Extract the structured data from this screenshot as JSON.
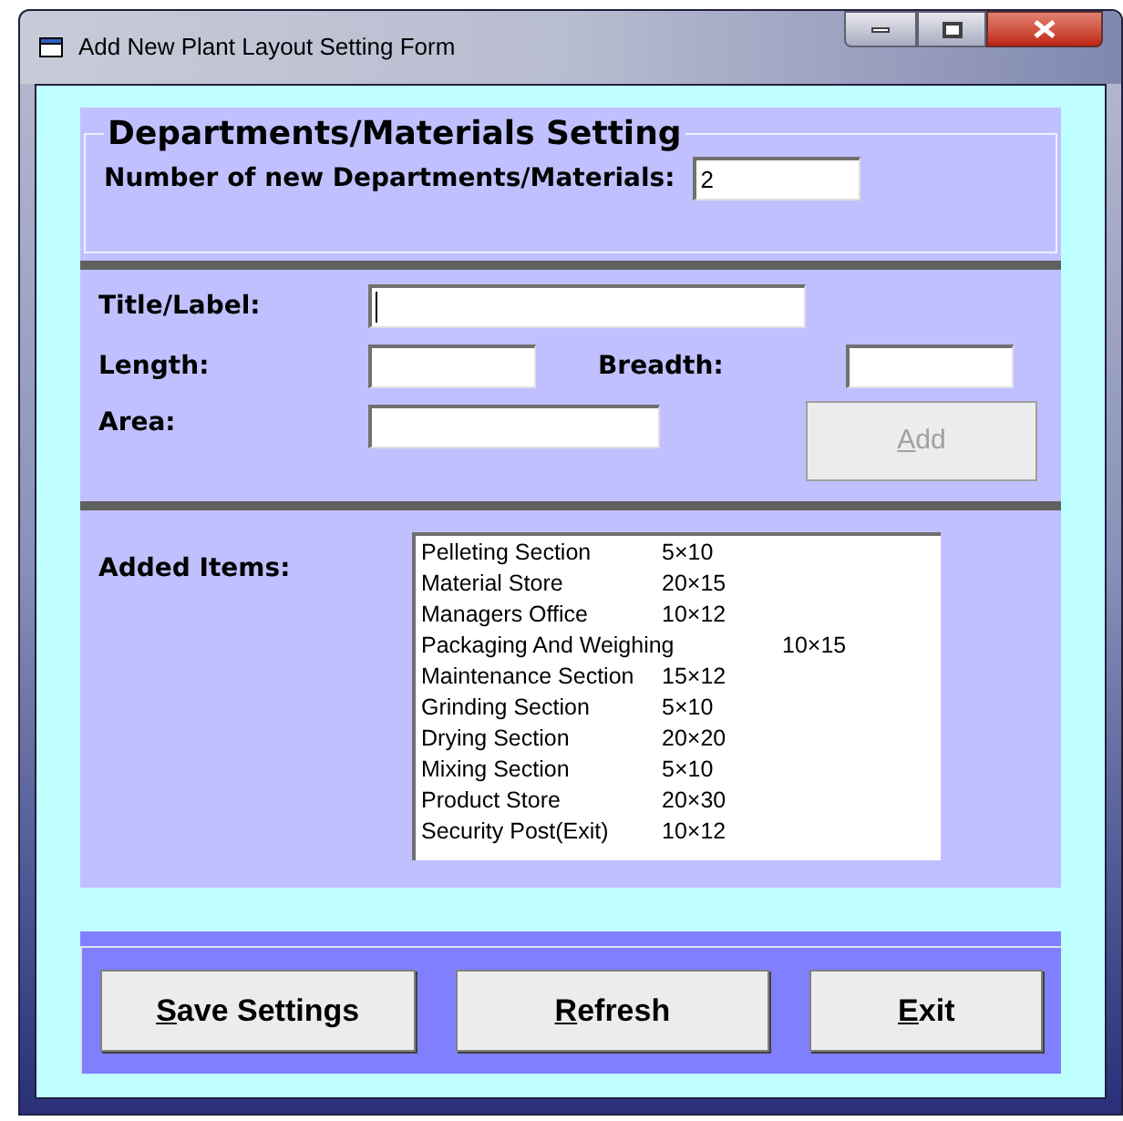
{
  "window": {
    "title": "Add New Plant Layout Setting Form"
  },
  "settings_group": {
    "title": "Departments/Materials Setting",
    "label": "Number of new Departments/Materials:",
    "value": "2"
  },
  "item_form": {
    "title_field": {
      "label": "Title/Label:",
      "focused": true
    },
    "length_field": {
      "label": "Length:"
    },
    "breadth_field": {
      "label": "Breadth:"
    },
    "area_field": {
      "label": "Area:"
    },
    "add_button": {
      "label": "Add",
      "disabled": true
    }
  },
  "added_items": {
    "label": "Added Items:",
    "items": [
      {
        "name": "Pelleting Section",
        "size": "5×10"
      },
      {
        "name": "Material Store",
        "size": "20×15"
      },
      {
        "name": "Managers Office",
        "size": "10×12"
      },
      {
        "name": "Packaging And Weighing",
        "size": "10×15"
      },
      {
        "name": "Maintenance Section",
        "size": "15×12"
      },
      {
        "name": "Grinding Section",
        "size": "5×10"
      },
      {
        "name": "Drying Section",
        "size": "20×20"
      },
      {
        "name": "Mixing Section",
        "size": "5×10"
      },
      {
        "name": "Product Store",
        "size": "20×30"
      },
      {
        "name": "Security Post(Exit)",
        "size": "10×12"
      }
    ]
  },
  "buttons": [
    {
      "label": "Save Settings"
    },
    {
      "label": "Refresh"
    },
    {
      "label": "Exit"
    }
  ]
}
